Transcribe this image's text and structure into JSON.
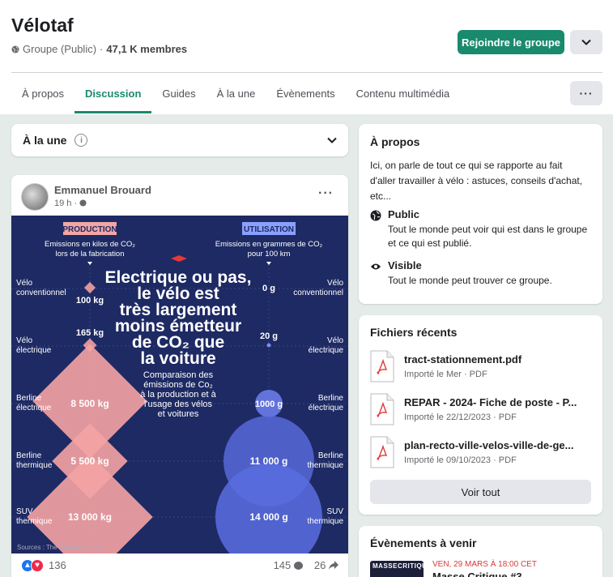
{
  "group": {
    "title": "Vélotaf",
    "privacy": "Groupe (Public)",
    "separator": " · ",
    "members": "47,1 K membres",
    "join_label": "Rejoindre le groupe"
  },
  "tabs": [
    "À propos",
    "Discussion",
    "Guides",
    "À la une",
    "Évènements",
    "Contenu multimédia"
  ],
  "active_tab": "Discussion",
  "more_label": "···",
  "featured": {
    "label": "À la une",
    "info": "i"
  },
  "post": {
    "author": "Emmanuel Brouard",
    "time": "19 h ·",
    "menu": "···",
    "reactions_count": "136",
    "comments_count": "145",
    "shares_count": "26",
    "image": {
      "badge_production": "PRODUCTION",
      "badge_usage": "UTILISATION",
      "production_sub_1": "Emissions en kilos de CO₂",
      "production_sub_2": "lors de la fabrication",
      "usage_sub_1": "Emissions en grammes de CO₂",
      "usage_sub_2": "pour 100 km",
      "headline": [
        "Electrique ou pas,",
        "le vélo est",
        "très largement",
        "moins émetteur",
        "de CO₂ que",
        "la voiture"
      ],
      "subline": [
        "Comparaison des",
        "émissions de Co₂",
        "à la production et à",
        "l'usage des vélos",
        "et voitures"
      ],
      "rows": [
        {
          "left": [
            "Vélo",
            "conventionnel"
          ],
          "right": [
            "Vélo",
            "conventionnel"
          ],
          "production": "100 kg",
          "usage": "0 g"
        },
        {
          "left": [
            "Vélo",
            "électrique"
          ],
          "right": [
            "Vélo",
            "électrique"
          ],
          "production": "165 kg",
          "usage": "20 g"
        },
        {
          "left": [
            "Berline",
            "électrique"
          ],
          "right": [
            "Berline",
            "électrique"
          ],
          "production": "8 500 kg",
          "usage": "1000 g"
        },
        {
          "left": [
            "Berline",
            "thermique"
          ],
          "right": [
            "Berline",
            "thermique"
          ],
          "production": "5 500 kg",
          "usage": "11 000 g"
        },
        {
          "left": [
            "SUV",
            "thermique"
          ],
          "right": [
            "SUV",
            "thermique"
          ],
          "production": "13 000 kg",
          "usage": "14 000 g"
        }
      ],
      "sources": "Sources : The Guardian, Trek"
    }
  },
  "about": {
    "title": "À propos",
    "description": "Ici, on parle de tout ce qui se rapporte au fait d'aller travailler à vélo : astuces, conseils d'achat, etc...",
    "public_title": "Public",
    "public_desc": "Tout le monde peut voir qui est dans le groupe et ce qui est publié.",
    "visible_title": "Visible",
    "visible_desc": "Tout le monde peut trouver ce groupe."
  },
  "files": {
    "title": "Fichiers récents",
    "items": [
      {
        "name": "tract-stationnement.pdf",
        "meta": "Importé le Mer · PDF"
      },
      {
        "name": "REPAR - 2024- Fiche de poste - P...",
        "meta": "Importé le 22/12/2023 · PDF"
      },
      {
        "name": "plan-recto-ville-velos-ville-de-ge...",
        "meta": "Importé le 09/10/2023 · PDF"
      }
    ],
    "see_all": "Voir tout"
  },
  "events": {
    "title": "Évènements à venir",
    "thumb_text": "MASSECRITIQUE",
    "date": "VEN, 29 MARS À 18:00 CET",
    "name": "Masse Critique #3"
  },
  "colors": {
    "accent": "#1a8a6d",
    "infographic_bg": "#1e2a63",
    "production": "#f0a0a0",
    "usage": "#5a6de0"
  }
}
